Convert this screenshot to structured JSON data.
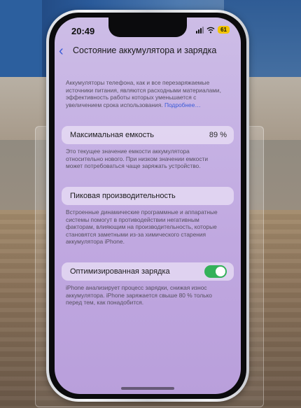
{
  "status_bar": {
    "time": "20:49",
    "battery": "61"
  },
  "nav": {
    "back_icon": "chevron-left-icon",
    "title": "Состояние аккумулятора и зарядка"
  },
  "intro": {
    "text": "Аккумуляторы телефона, как и все перезаряжаемые источники питания, являются расходными материалами, эффективность работы которых уменьшается с увеличением срока использования.",
    "link": "Подробнее…"
  },
  "max_capacity": {
    "label": "Максимальная емкость",
    "value": "89 %",
    "note": "Это текущее значение емкости аккумулятора относительно нового. При низком значении емкости может потребоваться чаще заряжать устройство."
  },
  "peak_performance": {
    "label": "Пиковая производительность",
    "note": "Встроенные динамические программные и аппаратные системы помогут в противодействии негативным факторам, влияющим на производительность, которые становятся заметными из-за химического старения аккумулятора iPhone."
  },
  "optimized_charging": {
    "label": "Оптимизированная зарядка",
    "enabled": true,
    "note": "iPhone анализирует процесс зарядки, снижая износ аккумулятора. iPhone заряжается свыше 80 % только перед тем, как понадобится."
  },
  "colors": {
    "accent": "#3b5bd8",
    "toggle_on": "#34b15a",
    "screen_bg": "#c6b2e4"
  }
}
